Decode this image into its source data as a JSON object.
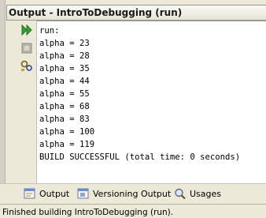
{
  "window": {
    "title": "Output - IntroToDebugging (run)"
  },
  "toolbar": {
    "rerun_icon": "double-play-icon",
    "stop_icon": "stop-icon",
    "settings_icon": "settings-icon"
  },
  "console": {
    "lines": [
      "run:",
      "alpha = 23",
      "alpha = 28",
      "alpha = 35",
      "alpha = 44",
      "alpha = 55",
      "alpha = 68",
      "alpha = 83",
      "alpha = 100",
      "alpha = 119",
      "BUILD SUCCESSFUL (total time: 0 seconds)"
    ]
  },
  "tabs": [
    {
      "label": "Output",
      "icon": "output-window-icon"
    },
    {
      "label": "Versioning Output",
      "icon": "versioning-window-icon"
    },
    {
      "label": "Usages",
      "icon": "magnifier-icon"
    }
  ],
  "status": {
    "text": "Finished building IntroToDebugging (run)."
  },
  "colors": {
    "accent_green": "#2f9a2f",
    "background": "#ece9d8",
    "console_bg": "#ffffff"
  }
}
